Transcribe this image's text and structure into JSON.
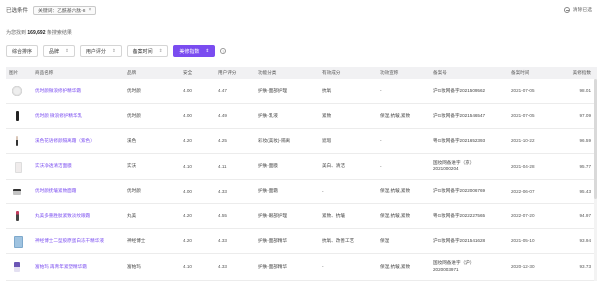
{
  "filter": {
    "label": "已选条件",
    "chip_text": "关键词：乙酰基六肽-8",
    "chip_close": "×",
    "clear_label": "清除已选"
  },
  "result": {
    "prefix": "为您找到",
    "count": "169,692",
    "suffix": "条搜索结果"
  },
  "tabs": [
    {
      "label": "综合排序",
      "arrow": "",
      "active": false
    },
    {
      "label": "品牌",
      "arrow": "⇕",
      "active": false
    },
    {
      "label": "用户评分",
      "arrow": "⇕",
      "active": false
    },
    {
      "label": "备案时间",
      "arrow": "⇕",
      "active": false
    },
    {
      "label": "美修指数",
      "arrow": "⇕",
      "active": true
    }
  ],
  "help_icon": "?",
  "table": {
    "headers": [
      "图片",
      "商品名称",
      "品牌",
      "安全",
      "用户评分",
      "功能分类",
      "有效成分",
      "功效宣称",
      "备案号",
      "备案时间",
      "美修指数"
    ],
    "rows": [
      {
        "thumb": "round",
        "name": "优时颜微浪修护精华霜",
        "brand": "优时颜",
        "safety": "4.00",
        "rating": "4.47",
        "category": "护肤-面部护理",
        "ingredients": "抗氧",
        "claims": "-",
        "reg": "沪G妆网备字2021509562",
        "date": "2021-07-05",
        "score": "98.01"
      },
      {
        "thumb": "tube",
        "name": "优时颜 微浪修护精华乳",
        "brand": "优时颜",
        "safety": "4.00",
        "rating": "4.49",
        "category": "护肤-乳液",
        "ingredients": "紧致",
        "claims": "保湿,抗皱,紧致",
        "reg": "沪G妆网备字2021546547",
        "date": "2021-07-05",
        "score": "97.09"
      },
      {
        "thumb": "pen",
        "name": "溪色花语修颜隔离霜（紫色）",
        "brand": "溪色",
        "safety": "4.20",
        "rating": "4.25",
        "category": "彩妆(美妆)-隔离",
        "ingredients": "遮瑕",
        "claims": "-",
        "reg": "粤G妆网备字2021652393",
        "date": "2021-10-22",
        "score": "96.59"
      },
      {
        "thumb": "light",
        "name": "实沃净透清洁面膜",
        "brand": "实沃",
        "safety": "4.10",
        "rating": "4.11",
        "category": "护肤-面膜",
        "ingredients": "美白、清洁",
        "claims": "-",
        "reg_lines": [
          "国妆网备进字（京）",
          "2021000204"
        ],
        "date": "2021-04-28",
        "score": "95.77"
      },
      {
        "thumb": "jar",
        "name": "优时颜抚皱紧致面霜",
        "brand": "优时颜",
        "safety": "4.00",
        "rating": "4.33",
        "category": "护肤-面霜",
        "ingredients": "-",
        "claims": "保湿,抗皱,紧致",
        "reg": "沪G妆网备字2022006769",
        "date": "2022-06-07",
        "score": "95.43"
      },
      {
        "thumb": "red",
        "name": "丸美多重胜肽紧致淡纹眼霜",
        "brand": "丸美",
        "safety": "4.20",
        "rating": "4.55",
        "category": "护肤-眼部护理",
        "ingredients": "紧致、抗皱",
        "claims": "保湿,抗皱,紧致",
        "reg": "粤G妆网备字2022227565",
        "date": "2022-07-20",
        "score": "94.97"
      },
      {
        "thumb": "box",
        "name": "神经博士二型胶原蛋白冻干精华液",
        "brand": "神经博士",
        "safety": "4.20",
        "rating": "4.33",
        "category": "护肤-面部精华",
        "ingredients": "抗氧、改善工艺",
        "claims": "保湿",
        "reg": "沪G妆网备字2021541628",
        "date": "2021-05-10",
        "score": "93.94"
      },
      {
        "thumb": "purple",
        "name": "富帕玛 再青年紧塑精华霜",
        "brand": "富帕玛",
        "safety": "4.10",
        "rating": "4.33",
        "category": "护肤-面部精华",
        "ingredients": "-",
        "claims": "保湿,抗皱,紧致",
        "reg_lines": [
          "国妆网备进字（沪）",
          "2020003971"
        ],
        "date": "2020-12-30",
        "score": "93.73"
      }
    ]
  }
}
